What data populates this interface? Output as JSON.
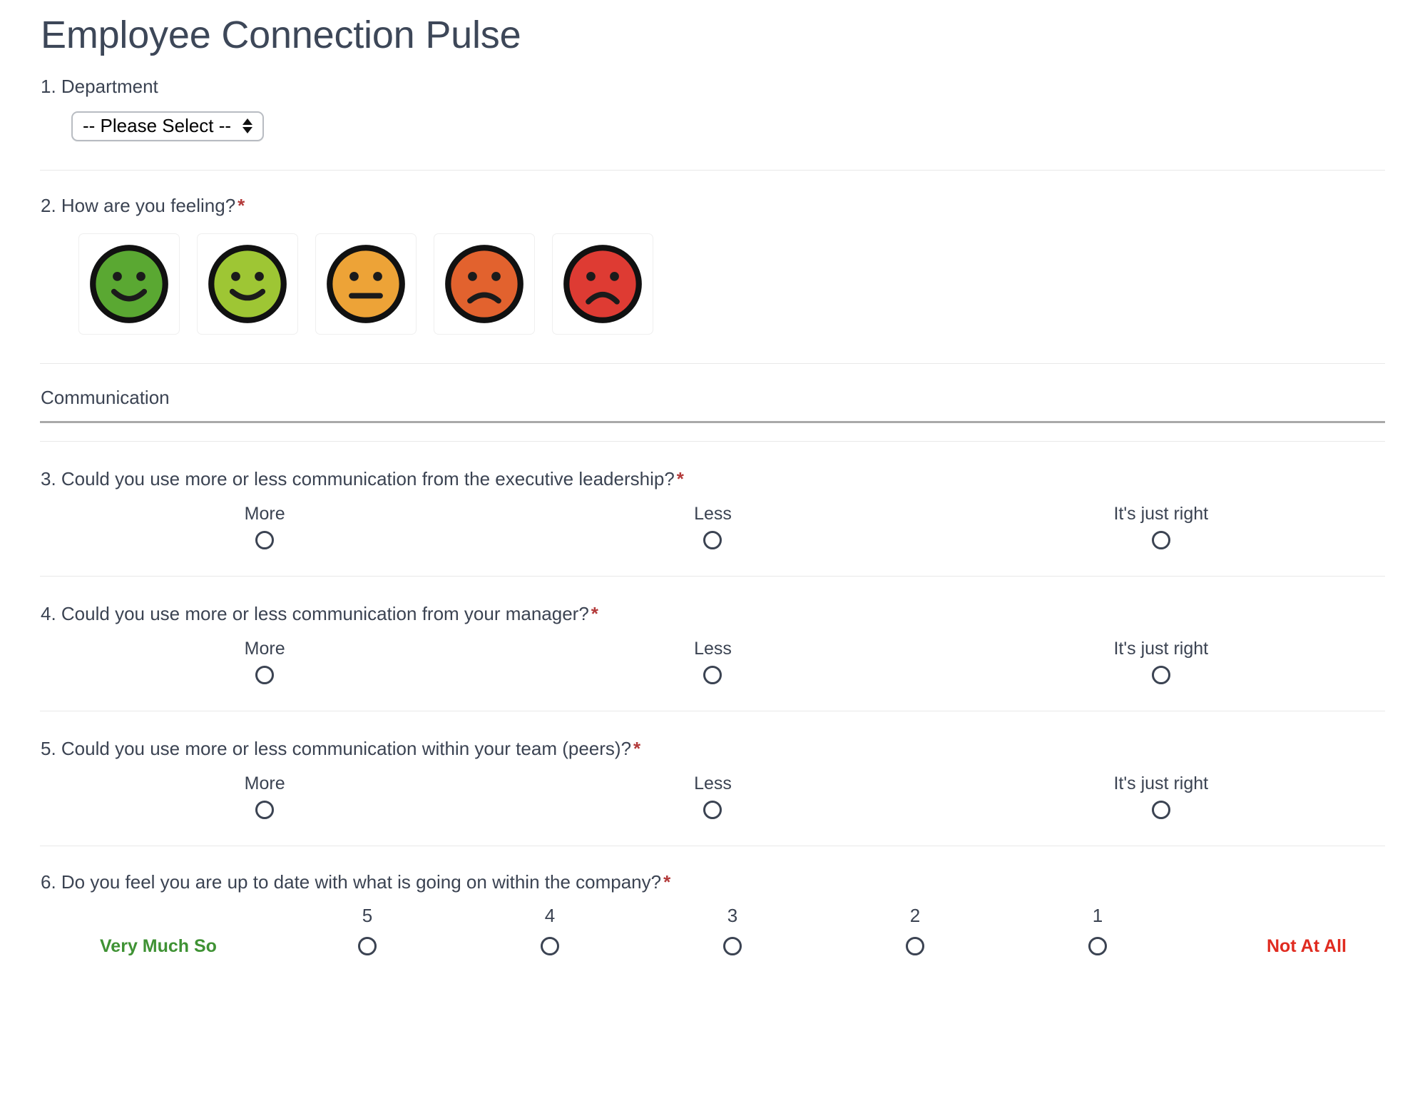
{
  "form": {
    "title": "Employee Connection Pulse"
  },
  "required_marker": "*",
  "questions": {
    "q1": {
      "label": "1. Department",
      "required": false,
      "select": {
        "value": "-- Please Select --",
        "icon": "stepper-updown-icon"
      }
    },
    "q2": {
      "label": "2. How are you feeling?",
      "required": true,
      "faces": [
        {
          "name": "smiley-very-happy",
          "expression": "happy",
          "color": "#5aa832"
        },
        {
          "name": "smiley-happy",
          "expression": "happy",
          "color": "#9ec634"
        },
        {
          "name": "smiley-neutral",
          "expression": "neutral",
          "color": "#eda337"
        },
        {
          "name": "smiley-sad",
          "expression": "sad",
          "color": "#e2622e"
        },
        {
          "name": "smiley-very-sad",
          "expression": "sad",
          "color": "#de3b33"
        }
      ]
    },
    "section_communication": {
      "label": "Communication"
    },
    "q3": {
      "label": "3. Could you use more or less communication from the executive leadership?",
      "required": true,
      "options": [
        "More",
        "Less",
        "It's just right"
      ]
    },
    "q4": {
      "label": "4. Could you use more or less communication from your manager?",
      "required": true,
      "options": [
        "More",
        "Less",
        "It's just right"
      ]
    },
    "q5": {
      "label": "5. Could you use more or less communication within your team (peers)?",
      "required": true,
      "options": [
        "More",
        "Less",
        "It's just right"
      ]
    },
    "q6": {
      "label": "6. Do you feel you are up to date with what is going on within the company?",
      "required": true,
      "scale_left_label": "Very Much So",
      "scale_right_label": "Not At All",
      "scale_points": [
        "5",
        "4",
        "3",
        "2",
        "1"
      ]
    }
  },
  "colors": {
    "text": "#3b4352",
    "required": "#b33a3a",
    "positive": "#3f9234",
    "negative": "#e02b20",
    "divider": "#e8e8e8",
    "section_rule": "#a9a9a9"
  }
}
